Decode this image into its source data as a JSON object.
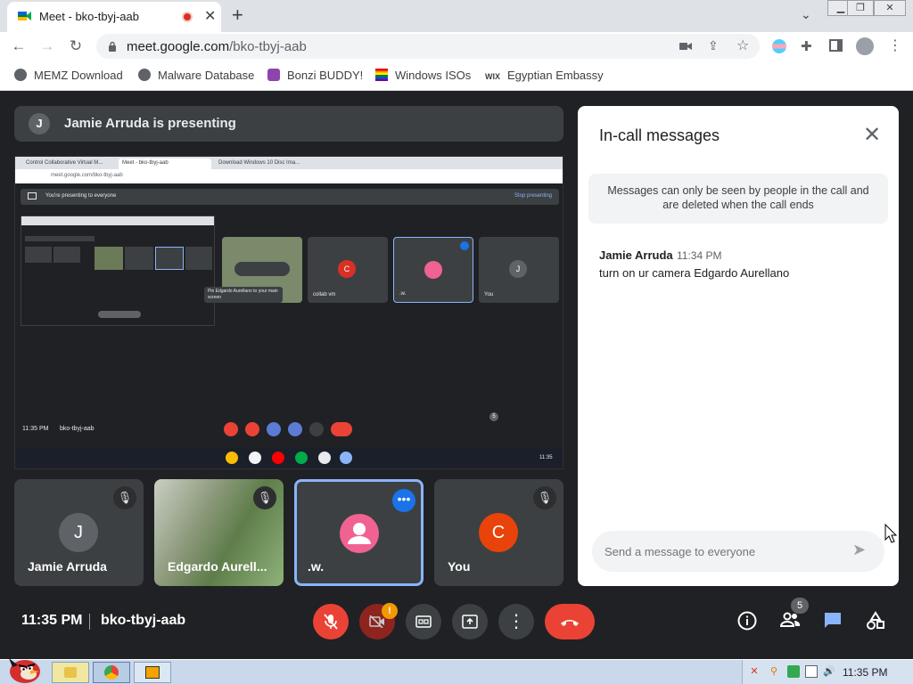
{
  "browser": {
    "tab_title": "Meet - bko-tbyj-aab",
    "url_host": "meet.google.com",
    "url_path": "/bko-tbyj-aab",
    "bookmarks": [
      {
        "label": "MEMZ Download",
        "icon": "globe-icon"
      },
      {
        "label": "Malware Database",
        "icon": "globe-icon"
      },
      {
        "label": "Bonzi BUDDY!",
        "icon": "bonzi-icon"
      },
      {
        "label": "Windows ISOs",
        "icon": "rainbow-flag-icon"
      },
      {
        "label": "Egyptian Embassy",
        "icon": "wix-icon"
      }
    ],
    "wix_text": "WIX"
  },
  "presenting": {
    "avatar_letter": "J",
    "banner_text": "Jamie Arruda is presenting"
  },
  "shared_screen": {
    "tabs": [
      "Control Collaborative Virtual M...",
      "Meet - bko-tbyj-aab",
      "Download Windows 10 Disc Ima..."
    ],
    "address": "meet.google.com/bko-tbyj-aab",
    "presenting_text": "You're presenting to everyone",
    "stop_text": "Stop presenting",
    "tooltip_text": "Pin Edgardo Aurellano to your main screen",
    "tiles": [
      {
        "letter": "C",
        "name": "collab vm"
      },
      {
        "letter": "",
        "name": ".w."
      },
      {
        "letter": "J",
        "name": "You"
      }
    ],
    "clock": "11:35 PM",
    "meeting_code": "bko-tbyj-aab",
    "people_count": "5",
    "taskbar_time": "11:35"
  },
  "participants": [
    {
      "name": "Jamie Arruda",
      "letter": "J",
      "avatar_color": "#5f6368"
    },
    {
      "name": "Edgardo Aurell...",
      "letter": "",
      "avatar_color": ""
    },
    {
      "name": ".w.",
      "letter": "",
      "avatar_color": "#f06292"
    },
    {
      "name": "You",
      "letter": "C",
      "avatar_color": "#e8430a"
    }
  ],
  "chat": {
    "title": "In-call messages",
    "note": "Messages can only be seen by people in the call and are deleted when the call ends",
    "messages": [
      {
        "sender": "Jamie Arruda",
        "time": "11:34 PM",
        "text": "turn on ur camera Edgardo Aurellano"
      }
    ],
    "input_placeholder": "Send a message to everyone"
  },
  "controls": {
    "clock": "11:35 PM",
    "meeting_code": "bko-tbyj-aab",
    "warning_badge": "!",
    "people_count": "5"
  },
  "os_taskbar": {
    "time": "11:35 PM"
  },
  "colors": {
    "end_call": "#ea4335",
    "accent": "#1a73e8",
    "meet_bg": "#202124"
  }
}
